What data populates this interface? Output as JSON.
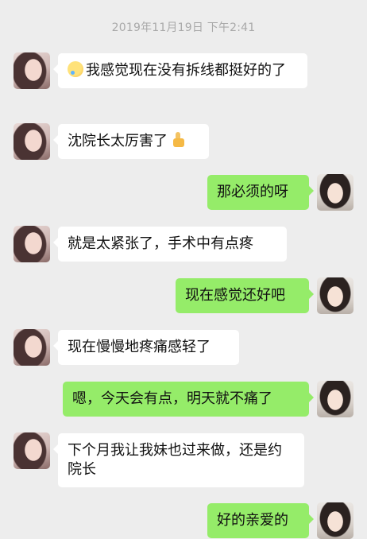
{
  "timestamp": "2019年11月19日 下午2:41",
  "messages": [
    {
      "side": "in",
      "text": "我感觉现在没有拆线都挺好的了",
      "emoji_before": "crying-laughing-emoji"
    },
    {
      "side": "in",
      "text": "沈院长太厉害了",
      "emoji_after": "thumbs-up-emoji"
    },
    {
      "side": "out",
      "text": "那必须的呀"
    },
    {
      "side": "in",
      "text": "就是太紧张了，手术中有点疼"
    },
    {
      "side": "out",
      "text": "现在感觉还好吧"
    },
    {
      "side": "in",
      "text": "现在慢慢地疼痛感轻了"
    },
    {
      "side": "out",
      "text": "嗯，今天会有点，明天就不痛了"
    },
    {
      "side": "in",
      "text": "下个月我让我妹也过来做，还是约院长"
    },
    {
      "side": "out",
      "text": "好的亲爱的"
    }
  ],
  "colors": {
    "background": "#ededed",
    "incoming": "#ffffff",
    "outgoing": "#95ec69",
    "timestamp": "#a9a9a9"
  }
}
